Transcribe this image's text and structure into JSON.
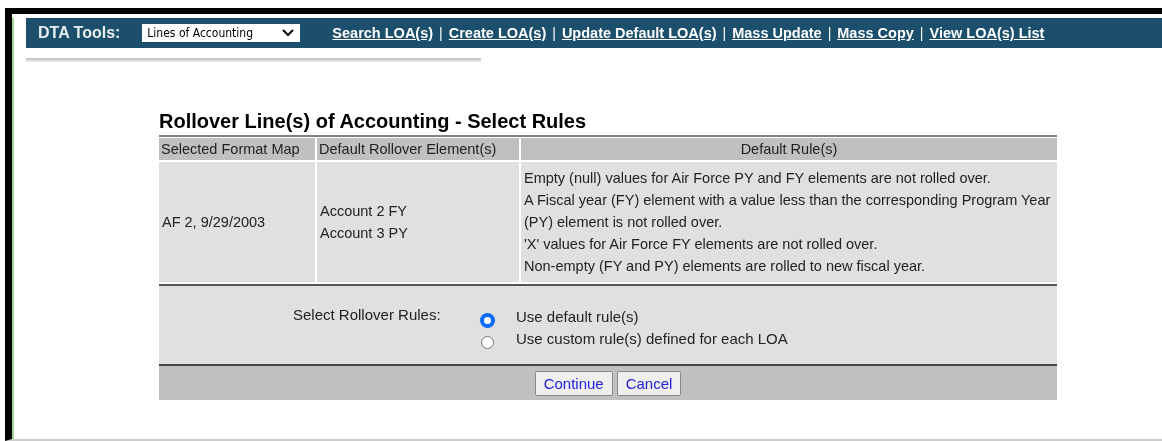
{
  "toolbar": {
    "label": "DTA Tools:",
    "select": {
      "value": "Lines of Accounting"
    },
    "separator": "|",
    "links": [
      "Search LOA(s)",
      "Create LOA(s)",
      "Update Default LOA(s)",
      "Mass Update",
      "Mass Copy",
      "View LOA(s) List"
    ]
  },
  "page_title": "Rollover Line(s) of Accounting - Select Rules",
  "table": {
    "columns": [
      "Selected Format Map",
      "Default Rollover Element(s)",
      "Default Rule(s)"
    ],
    "rows": [
      {
        "format_map": "AF 2, 9/29/2003",
        "elements": [
          "Account 2 FY",
          "Account 3 PY"
        ],
        "rules": [
          "Empty (null) values for Air Force PY and FY elements are not rolled over.",
          "A Fiscal year (FY) element with a value less than the corresponding Program Year (PY) element is not rolled over.",
          "'X' values for Air Force FY elements are not rolled over.",
          "Non-empty (FY and PY) elements are rolled to new fiscal year."
        ]
      }
    ]
  },
  "rollover_rules": {
    "label": "Select Rollover Rules:",
    "options": [
      {
        "label": "Use default rule(s)",
        "selected": true
      },
      {
        "label": "Use custom rule(s) defined for each LOA",
        "selected": false
      }
    ]
  },
  "buttons": [
    "Continue",
    "Cancel"
  ]
}
